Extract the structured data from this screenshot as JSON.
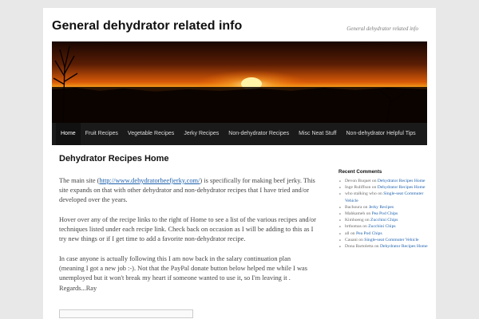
{
  "site": {
    "title": "General dehydrator related info",
    "description": "General dehydrator related info"
  },
  "nav": {
    "items": [
      {
        "label": "Home",
        "active": true
      },
      {
        "label": "Fruit Recipes"
      },
      {
        "label": "Vegetable Recipes"
      },
      {
        "label": "Jerky Recipes"
      },
      {
        "label": "Non-dehydrator Recipes"
      },
      {
        "label": "Misc Neat Stuff"
      },
      {
        "label": "Non-dehydrator Helpful Tips"
      }
    ]
  },
  "main": {
    "heading": "Dehydrator Recipes Home",
    "p1_before": "The main site (",
    "p1_link": "http://www.dehydratorbeefjerky.com/",
    "p1_after": ") is specifically for making beef jerky. This site expands on that with other dehydrator and non-dehydrator recipes that I have tried and/or developed over the years.",
    "p2": "Hover over any of the recipe links to the right of Home to see a list of the various recipes and/or techniques listed under each recipe link.  Check back on occasion as I will be adding to this as I try new things or if I get time to add a favorite non-dehydrator recipe.",
    "p3": "In case anyone is actually following this I am now back in the salary continuation plan (meaning I got a new job :-). Not that the PayPal donate button below helped me while I was unemployed but it won't break my heart if someone wanted to use it, so I'm leaving it . Regards...Ray"
  },
  "sidebar": {
    "title": "Recent Comments",
    "on": "on",
    "comments": [
      {
        "author": "Devon Buquet",
        "post": "Dehydrator Recipes Home"
      },
      {
        "author": "Inge Ruliffson",
        "post": "Dehydrator Recipes Home"
      },
      {
        "author": "who stalking who",
        "post": "Single-seat Commuter Vehicle"
      },
      {
        "author": "Bachoura",
        "post": "Jerky Recipes"
      },
      {
        "author": "Mahkameh",
        "post": "Pea Pod Chips"
      },
      {
        "author": "Kimhoeng",
        "post": "Zucchini Chips"
      },
      {
        "author": "brthomas",
        "post": "Zucchini Chips"
      },
      {
        "author": "all",
        "post": "Pea Pod Chips"
      },
      {
        "author": "Cauani",
        "post": "Single-seat Commuter Vehicle"
      },
      {
        "author": "Dona Bartoletta",
        "post": "Dehydrator Recipes Home"
      }
    ]
  },
  "colors": {
    "link": "#1b5fad",
    "nav_bg": "#1a1a1a",
    "page_bg": "#e8e8e8"
  }
}
